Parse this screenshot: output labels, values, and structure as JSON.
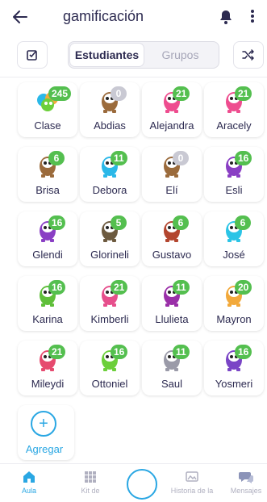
{
  "header": {
    "title": "gamificación"
  },
  "toolbar": {
    "tabs": [
      {
        "label": "Estudiantes",
        "active": true
      },
      {
        "label": "Grupos",
        "active": false
      }
    ]
  },
  "students": [
    {
      "name": "Clase",
      "points": "245",
      "avatar": "class-icon",
      "color": "#f2a93b"
    },
    {
      "name": "Abdias",
      "points": "0",
      "avatar": "monster-icon",
      "color": "#9b6b3c"
    },
    {
      "name": "Alejandra",
      "points": "21",
      "avatar": "monster-icon",
      "color": "#ee4d8f"
    },
    {
      "name": "Aracely",
      "points": "21",
      "avatar": "monster-icon",
      "color": "#ee4d8f"
    },
    {
      "name": "Brisa",
      "points": "6",
      "avatar": "monster-icon",
      "color": "#9b6b3c"
    },
    {
      "name": "Debora",
      "points": "11",
      "avatar": "monster-icon",
      "color": "#2bb8e8"
    },
    {
      "name": "Elí",
      "points": "0",
      "avatar": "monster-icon",
      "color": "#9b6b3c"
    },
    {
      "name": "Esli",
      "points": "16",
      "avatar": "monster-icon",
      "color": "#8a3fc4"
    },
    {
      "name": "Glendi",
      "points": "16",
      "avatar": "monster-icon",
      "color": "#8a3fc4"
    },
    {
      "name": "Glorineli",
      "points": "5",
      "avatar": "monster-icon",
      "color": "#6d5a3f"
    },
    {
      "name": "Gustavo",
      "points": "6",
      "avatar": "monster-icon",
      "color": "#b3462f"
    },
    {
      "name": "José",
      "points": "6",
      "avatar": "monster-icon",
      "color": "#2bc4e6"
    },
    {
      "name": "Karina",
      "points": "16",
      "avatar": "monster-icon",
      "color": "#5fbf3a"
    },
    {
      "name": "Kimberli",
      "points": "21",
      "avatar": "monster-icon",
      "color": "#e64f8c"
    },
    {
      "name": "Llulieta",
      "points": "11",
      "avatar": "monster-icon",
      "color": "#9a2fa8"
    },
    {
      "name": "Mayron",
      "points": "20",
      "avatar": "monster-icon",
      "color": "#f2a93b"
    },
    {
      "name": "Mileydi",
      "points": "21",
      "avatar": "monster-icon",
      "color": "#e64a6f"
    },
    {
      "name": "Ottoniel",
      "points": "16",
      "avatar": "monster-icon",
      "color": "#6ccf3a"
    },
    {
      "name": "Saul",
      "points": "11",
      "avatar": "monster-icon",
      "color": "#9a9aa8"
    },
    {
      "name": "Yosmeri",
      "points": "16",
      "avatar": "monster-icon",
      "color": "#7a45c6"
    }
  ],
  "add": {
    "label": "Agregar"
  },
  "bottom_nav": [
    {
      "label": "Aula",
      "active": true,
      "icon": "home-icon"
    },
    {
      "label": "Kit de",
      "active": false,
      "icon": "grid-icon"
    },
    {
      "label": "Historia de la",
      "active": false,
      "icon": "story-icon"
    },
    {
      "label": "Mensajes",
      "active": false,
      "icon": "chat-icon"
    }
  ],
  "colors": {
    "accent": "#2aa7e3",
    "badge": "#54bf4f",
    "badge_zero": "#c9c9d3",
    "text": "#2c2a50"
  }
}
